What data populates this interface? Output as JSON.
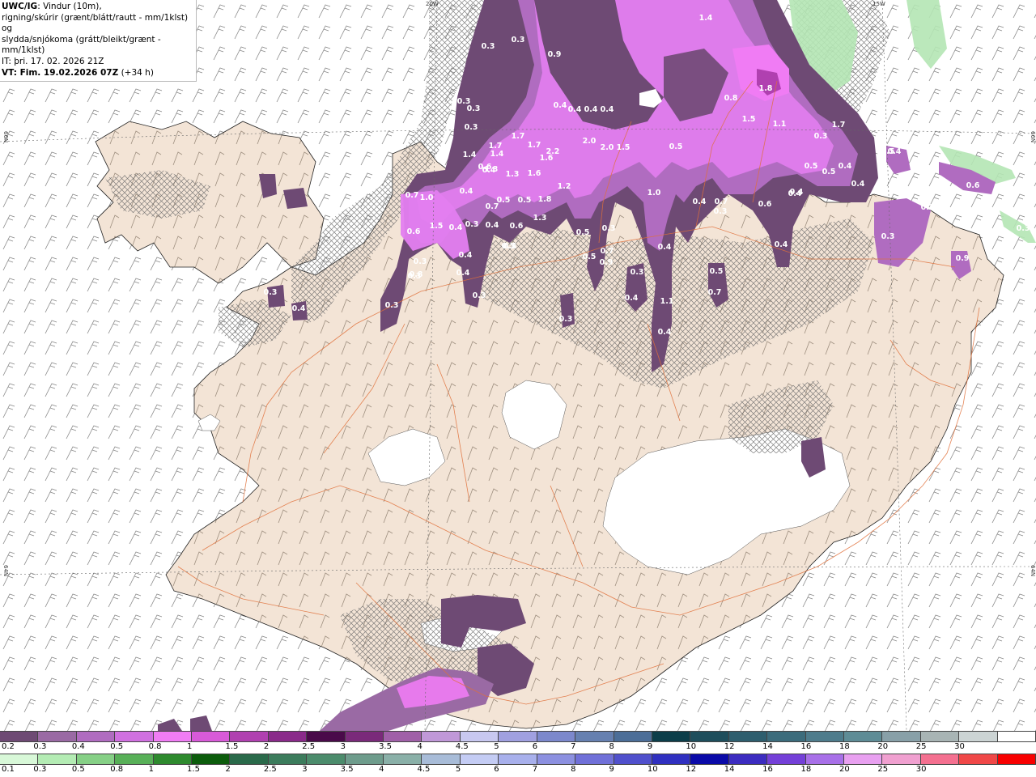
{
  "header": {
    "title_bold": "UWC/IG",
    "title_rest": ": Vindur (10m),",
    "line2": "rigning/skúrir (grænt/blátt/rautt - mm/1klst) og",
    "line3": "slydda/snjókoma (grátt/bleikt/grænt - mm/1klst)",
    "line4": "IT: þri. 17. 02. 2026 21Z",
    "line5_bold": "VT: Fim. 19.02.2026 07Z",
    "line5_rest": " (+34 h)"
  },
  "axis_labels": {
    "lon_20w": "20W",
    "lon_15w": "15W",
    "lat_66n_left": "66N",
    "lat_66n_right": "66N",
    "lat_64n_left": "64N",
    "lat_64n_right": "64N"
  },
  "legend_snow": {
    "colors": [
      "#6e4a74",
      "#9a6aa4",
      "#b06cc0",
      "#d070e0",
      "#f07cf4",
      "#d85ad8",
      "#b040b0",
      "#8a2a8a",
      "#4a0a4a",
      "#7a2a7a",
      "#a060a8",
      "#c098d8",
      "#c8c8f0",
      "#a0a0e0",
      "#7c88cc",
      "#6680b0",
      "#4c6e98",
      "#0c3e4a",
      "#1e4e5c",
      "#2e5e6e",
      "#3c6c7c",
      "#4e7c8c",
      "#5e8c96",
      "#88a0a8",
      "#a8b4b4",
      "#ccd4d4",
      "#ffffff"
    ],
    "ticks": [
      "0.2",
      "0.3",
      "0.4",
      "0.5",
      "0.8",
      "1",
      "1.5",
      "2",
      "2.5",
      "3",
      "3.5",
      "4",
      "4.5",
      "5",
      "6",
      "7",
      "8",
      "9",
      "10",
      "12",
      "14",
      "16",
      "18",
      "20",
      "25",
      "30"
    ]
  },
  "legend_rain": {
    "colors": [
      "#d8f8d8",
      "#b4ecb4",
      "#86d086",
      "#58b058",
      "#2e8a2e",
      "#0c5c0c",
      "#2a6a4a",
      "#3c7c5c",
      "#4c8c6c",
      "#6e9c8c",
      "#8ab0a8",
      "#a8bcd8",
      "#c4ccf4",
      "#a8b0ec",
      "#8c90e0",
      "#7070d8",
      "#5050cc",
      "#3030c0",
      "#0a0aa8",
      "#3c2cc0",
      "#7440d8",
      "#a870e8",
      "#e8a0f0",
      "#f0a0d0",
      "#f47090",
      "#f04848",
      "#f80000"
    ],
    "ticks": [
      "0.1",
      "0.3",
      "0.5",
      "0.8",
      "1",
      "1.5",
      "2",
      "2.5",
      "3",
      "3.5",
      "4",
      "4.5",
      "5",
      "6",
      "7",
      "8",
      "9",
      "10",
      "12",
      "14",
      "16",
      "18",
      "20",
      "25",
      "30"
    ]
  },
  "precip_labels": [
    "1.4",
    "0.3",
    "0.3",
    "0.9",
    "0.3",
    "0.3",
    "0.4",
    "0.4",
    "0.4",
    "0.4",
    "1.8",
    "0.3",
    "0.8",
    "1.5",
    "1.1",
    "1.7",
    "1.7",
    "1.7",
    "1.7",
    "2.2",
    "2.0",
    "2.0",
    "1.5",
    "0.5",
    "0.3",
    "1.4",
    "1.3",
    "1.6",
    "1.4",
    "1.3",
    "1.2",
    "1.6",
    "0.5",
    "0.5",
    "0.6",
    "1.8",
    "1.3",
    "0.7",
    "1.0",
    "0.4",
    "0.4",
    "1.5",
    "1.5",
    "0.4",
    "0.7",
    "0.5",
    "0.5",
    "1.0",
    "0.4",
    "0.3",
    "0.4",
    "0.6",
    "0.6",
    "0.4",
    "0.3",
    "0.3",
    "0.4",
    "0.8",
    "0.4",
    "0.5",
    "0.5",
    "0.5",
    "0.3",
    "0.7",
    "0.9",
    "0.7",
    "0.6",
    "0.4",
    "0.3",
    "0.4",
    "0.3",
    "0.4",
    "0.4",
    "0.3",
    "0.3",
    "0.4",
    "1.1",
    "0.5",
    "0.7",
    "0.9",
    "0.3",
    "0.2",
    "0.3",
    "0.4",
    "0.6",
    "0.4",
    "0.4",
    "0.4",
    "0.3",
    "0.3",
    "0.4"
  ]
}
